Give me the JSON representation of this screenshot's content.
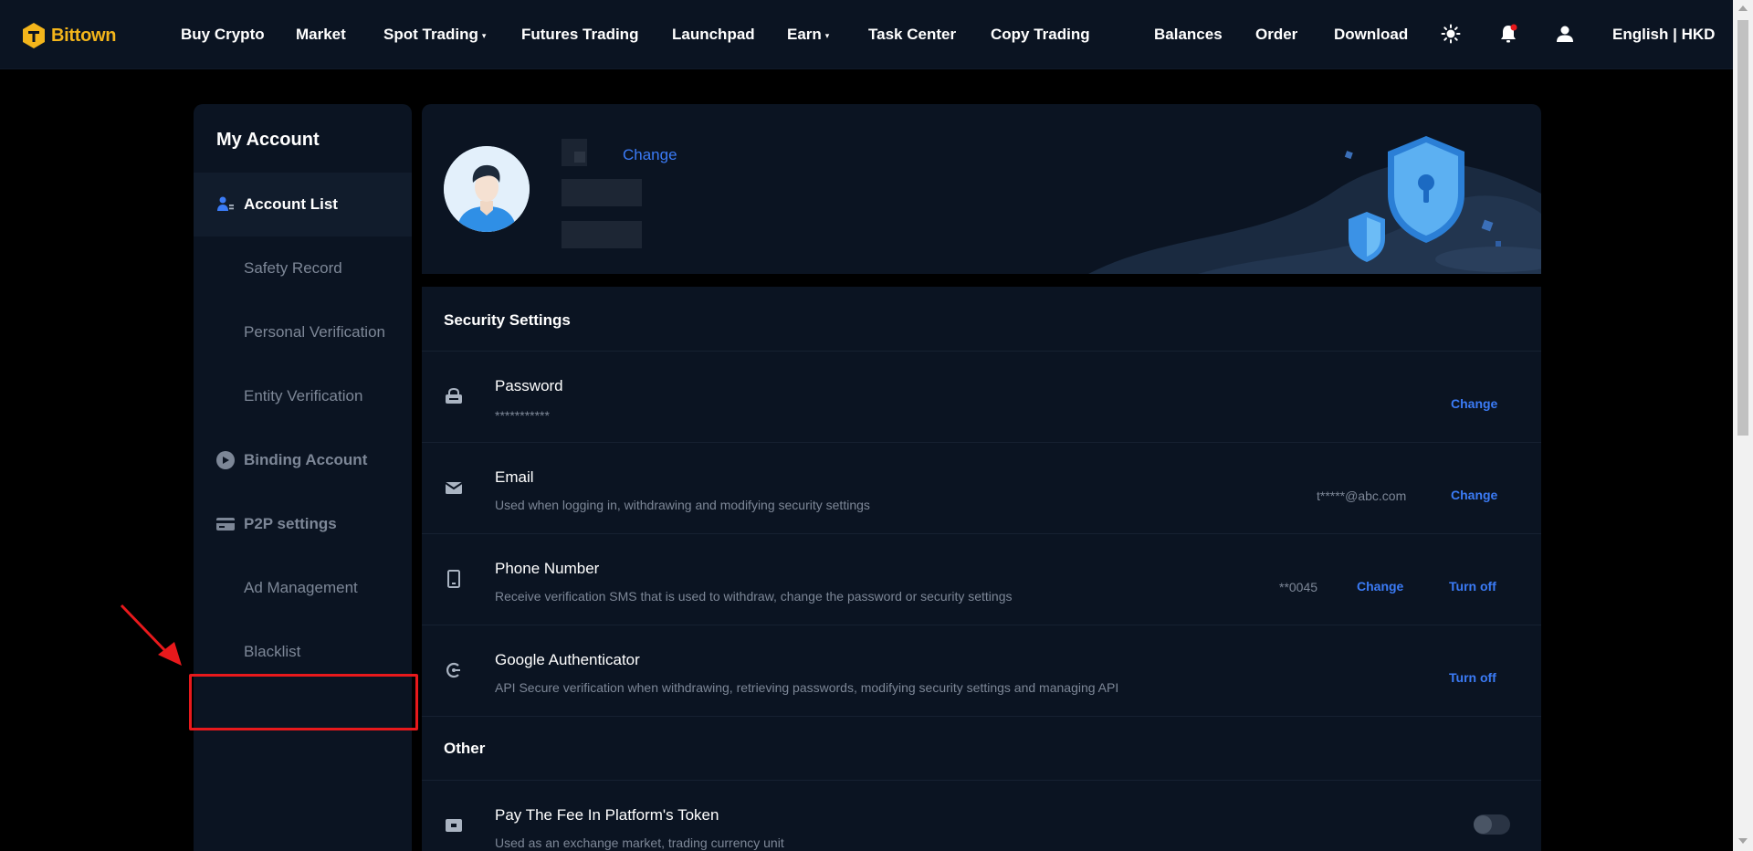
{
  "brand": {
    "name": "Bittown",
    "color": "#f3b51b"
  },
  "nav": {
    "items": [
      {
        "label": "Buy Crypto",
        "caret": ""
      },
      {
        "label": "Market",
        "caret": ""
      },
      {
        "label": "Spot Trading",
        "caret": "▾"
      },
      {
        "label": "Futures Trading",
        "caret": ""
      },
      {
        "label": "Launchpad",
        "caret": ""
      },
      {
        "label": "Earn",
        "caret": "▾"
      },
      {
        "label": "Task Center",
        "caret": ""
      },
      {
        "label": "Copy Trading",
        "caret": ""
      }
    ],
    "right": [
      {
        "label": "Balances"
      },
      {
        "label": "Order"
      },
      {
        "label": "Download"
      }
    ],
    "icons": [
      "sun-icon",
      "bell-icon",
      "user-icon"
    ],
    "language": "English | HKD"
  },
  "sidebar": {
    "title": "My Account",
    "items": [
      {
        "label": "Account List",
        "icon": "account-list-icon",
        "state": "active"
      },
      {
        "label": "Safety Record",
        "icon": "",
        "state": "sub"
      },
      {
        "label": "Personal Verification",
        "icon": "",
        "state": "sub"
      },
      {
        "label": "Entity Verification",
        "icon": "",
        "state": "sub"
      },
      {
        "label": "Binding Account",
        "icon": "binding-icon",
        "state": "group"
      },
      {
        "label": "P2P settings",
        "icon": "card-icon",
        "state": "group"
      },
      {
        "label": "Ad Management",
        "icon": "",
        "state": "sub"
      },
      {
        "label": "Blacklist",
        "icon": "",
        "state": "sub"
      }
    ]
  },
  "profile": {
    "change_label": "Change"
  },
  "security": {
    "heading": "Security Settings",
    "rows": [
      {
        "title": "Password",
        "desc": "***********",
        "value": "",
        "actions": [
          "Change"
        ],
        "icon": "lock-icon"
      },
      {
        "title": "Email",
        "desc": "Used when logging in, withdrawing and modifying security settings",
        "value": "t*****@abc.com",
        "actions": [
          "Change"
        ],
        "icon": "mail-icon"
      },
      {
        "title": "Phone Number",
        "desc": "Receive verification SMS that is used to withdraw, change the password or security settings",
        "value": "**0045",
        "actions": [
          "Change",
          "Turn off"
        ],
        "icon": "phone-icon"
      },
      {
        "title": "Google Authenticator",
        "desc": "API Secure verification when withdrawing, retrieving passwords, modifying security settings and managing API",
        "value": "",
        "actions": [
          "Turn off"
        ],
        "icon": "authenticator-icon"
      }
    ]
  },
  "other": {
    "heading": "Other",
    "rows": [
      {
        "title": "Pay The Fee In Platform's Token",
        "desc": "Used as an exchange market, trading currency unit",
        "toggle": "off",
        "icon": "token-icon"
      }
    ]
  },
  "colors": {
    "accent": "#3b7bf6",
    "annotation": "#e8191c",
    "panel": "#0b1422"
  }
}
